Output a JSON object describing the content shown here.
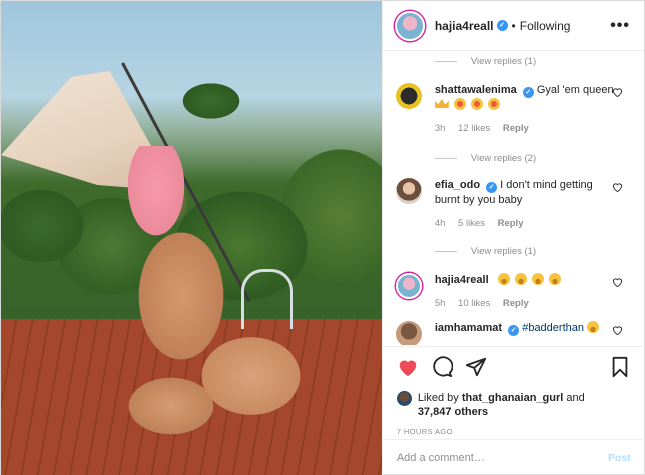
{
  "header": {
    "username": "hajia4reall",
    "separator": "•",
    "follow_label": "Following",
    "more_label": "•••"
  },
  "comments": [
    {
      "type": "view_replies",
      "label": "View replies (1)"
    },
    {
      "type": "comment",
      "username": "shattawalenima",
      "verified": true,
      "text": "Gyal 'em queen",
      "emojis": [
        "crown",
        "star",
        "star",
        "star"
      ],
      "time": "3h",
      "likes": "12 likes",
      "reply_label": "Reply",
      "avatar": "shatta"
    },
    {
      "type": "view_replies",
      "label": "View replies (2)"
    },
    {
      "type": "comment",
      "username": "efia_odo",
      "verified": true,
      "text": "I don't mind getting burnt by you baby",
      "emojis": [],
      "time": "4h",
      "likes": "5 likes",
      "reply_label": "Reply",
      "avatar": "efia"
    },
    {
      "type": "view_replies",
      "label": "View replies (1)"
    },
    {
      "type": "comment",
      "username": "hajia4reall",
      "verified": false,
      "text": "",
      "emojis": [
        "smile",
        "smile",
        "smile",
        "smile"
      ],
      "time": "5h",
      "likes": "10 likes",
      "reply_label": "Reply",
      "avatar": "hajia"
    },
    {
      "type": "comment",
      "username": "iamhamamat",
      "verified": true,
      "text": "#badderthan",
      "emojis": [
        "smile"
      ],
      "time": "",
      "likes": "",
      "reply_label": "",
      "avatar": "iam"
    }
  ],
  "likes": {
    "prefix": "Liked by",
    "user": "that_ghanaian_gurl",
    "middle": "and",
    "count": "37,847 others"
  },
  "timestamp": "7 HOURS AGO",
  "add_comment": {
    "placeholder": "Add a comment…",
    "post_label": "Post"
  },
  "icons": {
    "like": "heart-icon",
    "comment": "comment-icon",
    "share": "share-icon",
    "save": "bookmark-icon"
  },
  "colors": {
    "like_red": "#ed4956",
    "verified_blue": "#3897f0",
    "post_disabled": "#b2dffc",
    "muted": "#8e8e8e"
  }
}
